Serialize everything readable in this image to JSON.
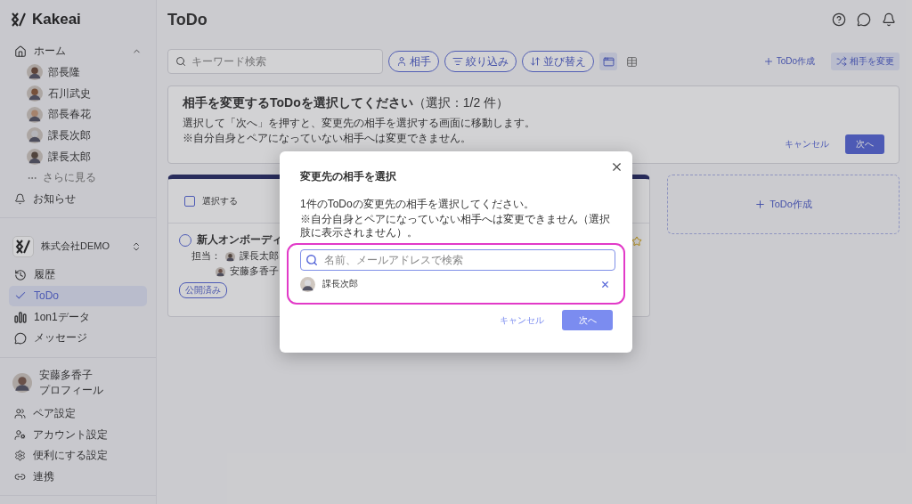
{
  "app": {
    "logo": "Kakeai"
  },
  "sidebar": {
    "home": {
      "label": "ホーム",
      "expanded": true
    },
    "members": [
      {
        "name": "部長隆"
      },
      {
        "name": "石川武史"
      },
      {
        "name": "部長春花"
      },
      {
        "name": "課長次郎"
      },
      {
        "name": "課長太郎"
      }
    ],
    "more": "さらに見る",
    "notifications": "お知らせ",
    "company": "株式会社DEMO",
    "nav": [
      {
        "label": "履歴",
        "selected": false
      },
      {
        "label": "ToDo",
        "selected": true
      },
      {
        "label": "1on1データ",
        "selected": false
      },
      {
        "label": "メッセージ",
        "selected": false
      }
    ],
    "profile": {
      "name": "安藤多香子",
      "sub": "プロフィール"
    },
    "settings": [
      {
        "label": "ペア設定"
      },
      {
        "label": "アカウント設定"
      },
      {
        "label": "便利にする設定"
      },
      {
        "label": "連携"
      }
    ]
  },
  "header": {
    "title": "ToDo"
  },
  "toolbar": {
    "search_placeholder": "キーワード検索",
    "filters": [
      {
        "label": "相手"
      },
      {
        "label": "絞り込み"
      },
      {
        "label": "並び替え"
      }
    ],
    "views": [
      {
        "kind": "card",
        "selected": true
      },
      {
        "kind": "table",
        "selected": false
      }
    ],
    "create": "ToDo作成",
    "change": "相手を変更"
  },
  "banner": {
    "title": "相手を変更するToDoを選択してください",
    "count": "（選択：1/2 件）",
    "lines": [
      "選択して「次へ」を押すと、変更先の相手を選択する画面に移動します。",
      "※自分自身とペアになっていない相手へは変更できません。"
    ],
    "cancel": "キャンセル",
    "next": "次へ"
  },
  "card": {
    "select_label": "選択する",
    "select_checked": false,
    "item": {
      "title": "新人オンボーディ",
      "done": false,
      "assignee_label": "担当：",
      "assignees": [
        "課長太郎",
        "安藤多香子"
      ],
      "tag": "公開済み"
    }
  },
  "create_card": "ToDo作成",
  "modal": {
    "title": "変更先の相手を選択",
    "desc": "1件のToDoの変更先の相手を選択してください。",
    "note": "※自分自身とペアになっていない相手へは変更できません（選択肢に表示されません）。",
    "search": {
      "placeholder": "名前、メールアドレスで検索"
    },
    "selected": [
      {
        "name": "課長次郎"
      }
    ],
    "cancel": "キャンセル",
    "next": "次へ"
  }
}
